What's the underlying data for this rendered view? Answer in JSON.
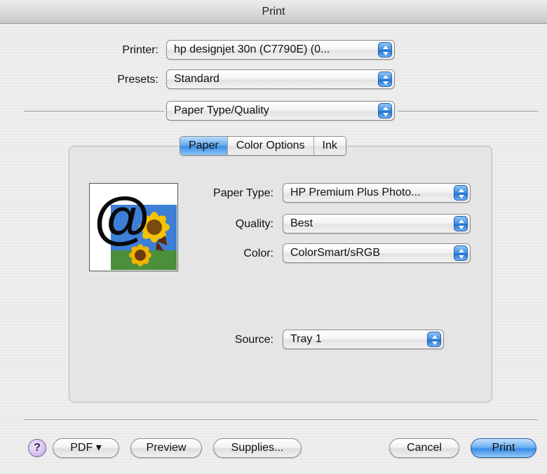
{
  "window": {
    "title": "Print"
  },
  "printer": {
    "label": "Printer:",
    "value": "hp designjet 30n (C7790E) (0..."
  },
  "presets": {
    "label": "Presets:",
    "value": "Standard"
  },
  "panel": {
    "value": "Paper Type/Quality"
  },
  "tabs": [
    {
      "label": "Paper",
      "active": true
    },
    {
      "label": "Color Options",
      "active": false
    },
    {
      "label": "Ink",
      "active": false
    }
  ],
  "preview": {
    "glyph": "@"
  },
  "paper": {
    "paper_type": {
      "label": "Paper Type:",
      "value": "HP Premium Plus Photo..."
    },
    "quality": {
      "label": "Quality:",
      "value": "Best"
    },
    "color": {
      "label": "Color:",
      "value": "ColorSmart/sRGB"
    },
    "source": {
      "label": "Source:",
      "value": "Tray 1"
    }
  },
  "buttons": {
    "help": "?",
    "pdf": "PDF ▾",
    "preview": "Preview",
    "supplies": "Supplies...",
    "cancel": "Cancel",
    "print": "Print"
  },
  "colors": {
    "accent": "#3d8fe6",
    "window_bg": "#ececec"
  }
}
